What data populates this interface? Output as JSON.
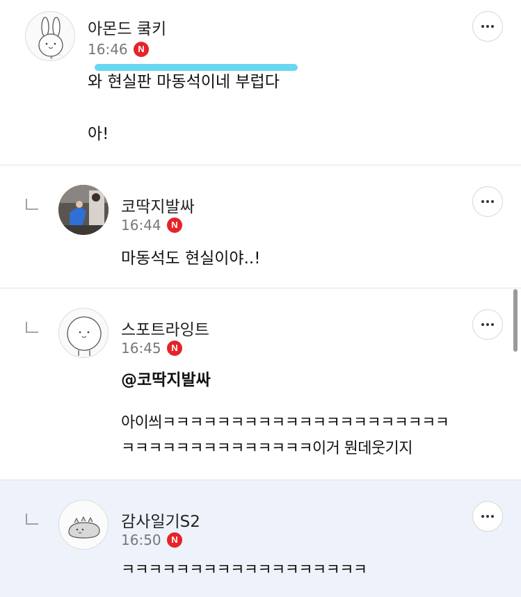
{
  "comments": [
    {
      "author": "아몬드 쿸키",
      "time": "16:46",
      "badge": "N",
      "is_reply": false,
      "lines": [
        "와 현실판 마동석이네 부럽다",
        "아!"
      ]
    },
    {
      "author": "코딱지발싸",
      "time": "16:44",
      "badge": "N",
      "is_reply": true,
      "lines": [
        "마동석도 현실이야..!"
      ]
    },
    {
      "author": "스포트라잉트",
      "time": "16:45",
      "badge": "N",
      "is_reply": true,
      "mention": "@코딱지발싸",
      "lines": [
        "아이씌ㅋㅋㅋㅋㅋㅋㅋㅋㅋㅋㅋㅋㅋㅋㅋㅋㅋㅋㅋㅋㅋ",
        "ㅋㅋㅋㅋㅋㅋㅋㅋㅋㅋㅋㅋㅋㅋ이거 뭔데웃기지"
      ]
    },
    {
      "author": "감사일기S2",
      "time": "16:50",
      "badge": "N",
      "is_reply": true,
      "highlighted": true,
      "lines": [
        "ㅋㅋㅋㅋㅋㅋㅋㅋㅋㅋㅋㅋㅋㅋㅋㅋㅋㅋ"
      ]
    }
  ],
  "icons": {
    "more": "more-horizontal-icon",
    "reply": "reply-arrow-icon",
    "badge": "new-badge-icon"
  },
  "colors": {
    "badge": "#e52329",
    "highlight_bg": "#eef3fb",
    "divider": "#e3e3e3",
    "marker": "#4fd0f2"
  }
}
